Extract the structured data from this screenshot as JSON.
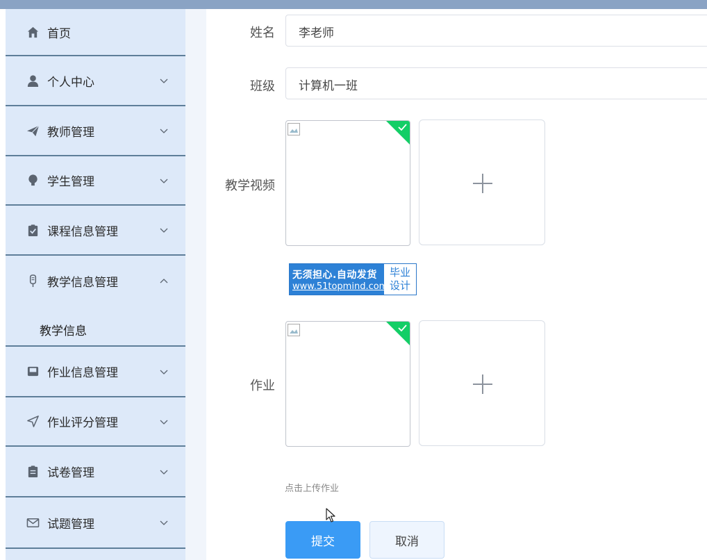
{
  "sidebar": {
    "items": [
      {
        "label": "首页",
        "icon": "home-icon",
        "has_chevron": false
      },
      {
        "label": "个人中心",
        "icon": "user-icon",
        "has_chevron": true
      },
      {
        "label": "教师管理",
        "icon": "paper-plane-icon",
        "has_chevron": true
      },
      {
        "label": "学生管理",
        "icon": "lightbulb-icon",
        "has_chevron": true
      },
      {
        "label": "课程信息管理",
        "icon": "clipboard-check-icon",
        "has_chevron": true
      },
      {
        "label": "教学信息管理",
        "icon": "microphone-icon",
        "has_chevron": true,
        "expanded": true
      },
      {
        "label": "作业信息管理",
        "icon": "inbox-icon",
        "has_chevron": true
      },
      {
        "label": "作业评分管理",
        "icon": "navigation-icon",
        "has_chevron": true
      },
      {
        "label": "试卷管理",
        "icon": "clipboard-icon",
        "has_chevron": true
      },
      {
        "label": "试题管理",
        "icon": "mail-icon",
        "has_chevron": true
      }
    ],
    "sub_item": {
      "label": "教学信息"
    }
  },
  "form": {
    "name": {
      "label": "姓名",
      "value": "李老师"
    },
    "class": {
      "label": "班级",
      "value": "计算机一班"
    },
    "video": {
      "label": "教学视频"
    },
    "homework": {
      "label": "作业",
      "hint": "点击上传作业"
    }
  },
  "watermark": {
    "line1": "无须担心.自动发货",
    "line2": "www.51topmind.com",
    "right1": "毕业",
    "right2": "设计"
  },
  "buttons": {
    "submit": "提交",
    "cancel": "取消"
  },
  "colors": {
    "sidebar_bg": "#dde9f9",
    "primary": "#3a9bf5",
    "success": "#13ce66",
    "topbar": "#8aa3c4"
  }
}
